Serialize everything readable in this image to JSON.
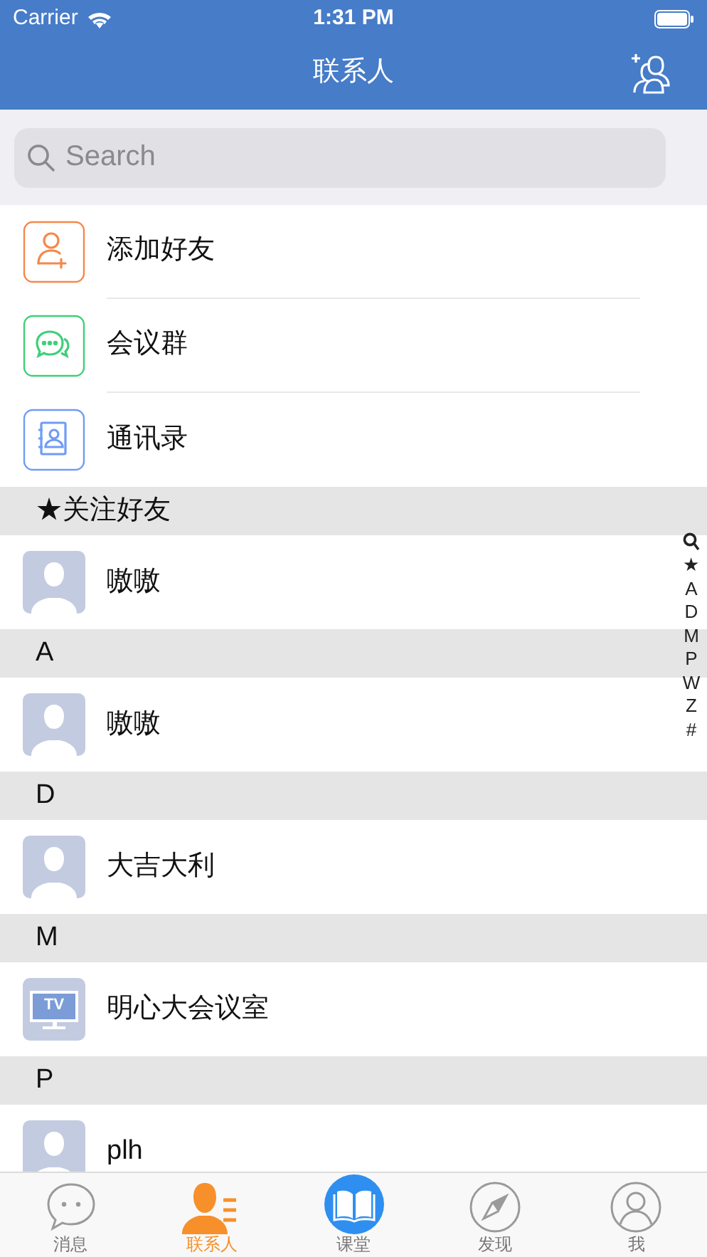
{
  "status_bar": {
    "carrier": "Carrier",
    "time": "1:31 PM"
  },
  "nav": {
    "title": "联系人"
  },
  "search": {
    "placeholder": "Search"
  },
  "quick_items": [
    {
      "label": "添加好友",
      "kind": "add",
      "color": "#f5884a"
    },
    {
      "label": "会议群",
      "kind": "chat",
      "color": "#3fcf7a"
    },
    {
      "label": "通讯录",
      "kind": "book",
      "color": "#6f9cf5"
    }
  ],
  "sections": [
    {
      "header": "★关注好友",
      "rows": [
        {
          "name": "嗷嗷",
          "kind": "person"
        }
      ]
    },
    {
      "header": "A",
      "rows": [
        {
          "name": "嗷嗷",
          "kind": "person"
        }
      ]
    },
    {
      "header": "D",
      "rows": [
        {
          "name": "大吉大利",
          "kind": "person"
        }
      ]
    },
    {
      "header": "M",
      "rows": [
        {
          "name": "明心大会议室",
          "kind": "tv",
          "badge": "TV"
        }
      ]
    },
    {
      "header": "P",
      "rows": [
        {
          "name": "plh",
          "kind": "person"
        }
      ]
    }
  ],
  "index": [
    "★",
    "A",
    "D",
    "M",
    "P",
    "W",
    "Z",
    "#"
  ],
  "tabs": [
    {
      "label": "消息",
      "kind": "chat",
      "selected": false
    },
    {
      "label": "联系人",
      "kind": "contacts",
      "selected": true
    },
    {
      "label": "课堂",
      "kind": "book",
      "selected": false
    },
    {
      "label": "发现",
      "kind": "compass",
      "selected": false
    },
    {
      "label": "我",
      "kind": "me",
      "selected": false
    }
  ]
}
